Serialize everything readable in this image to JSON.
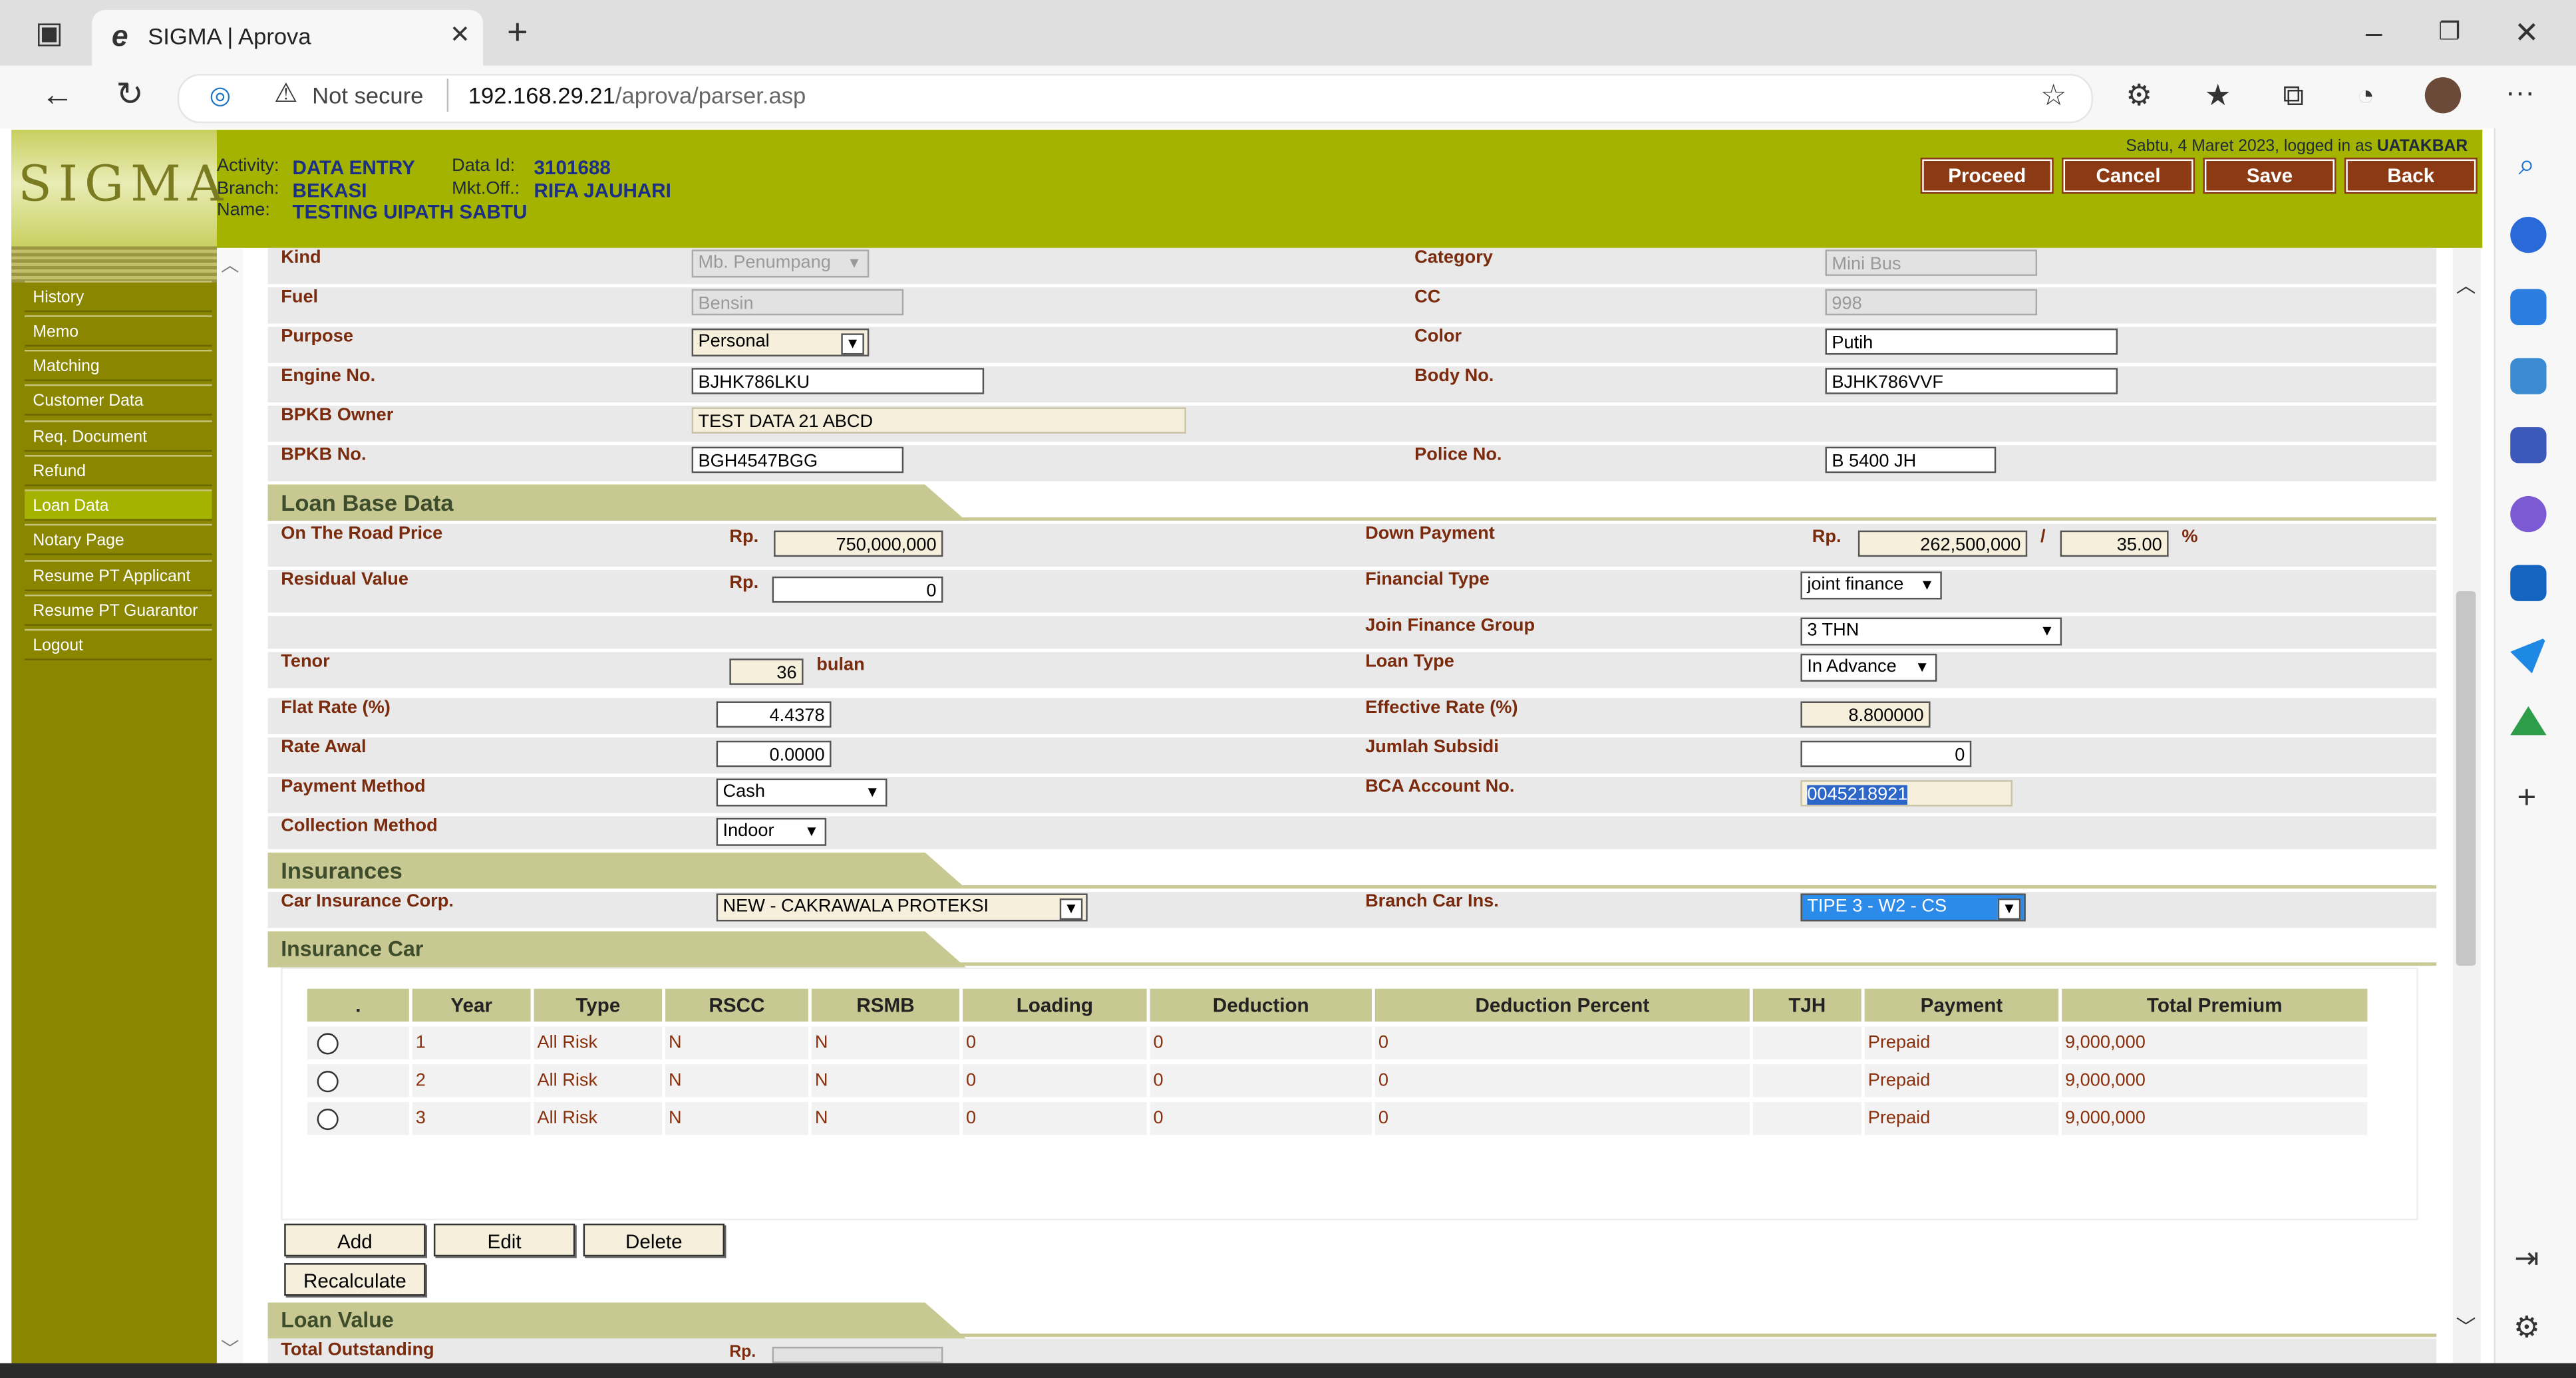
{
  "browser": {
    "tab_title": "SIGMA | Aprova",
    "security": "Not secure",
    "url_host": "192.168.29.21",
    "url_path": "/aprova/parser.asp"
  },
  "header": {
    "logo": "SIGMA",
    "activity_label": "Activity:",
    "activity_value": "DATA ENTRY",
    "branch_label": "Branch:",
    "branch_value": "BEKASI",
    "name_label": "Name:",
    "name_value": "TESTING UIPATH SABTU",
    "dataid_label": "Data Id:",
    "dataid_value": "3101688",
    "mktoff_label": "Mkt.Off.:",
    "mktoff_value": "RIFA JAUHARI",
    "login_info": "Sabtu, 4 Maret 2023, logged in as",
    "login_user": "UATAKBAR",
    "buttons": [
      "Proceed",
      "Cancel",
      "Save",
      "Back"
    ]
  },
  "nav": {
    "items": [
      "History",
      "Memo",
      "Matching",
      "Customer Data",
      "Req. Document",
      "Refund",
      "Loan Data",
      "Notary Page",
      "Resume PT Applicant",
      "Resume PT Guarantor",
      "Logout"
    ],
    "active": "Loan Data"
  },
  "vehicle": {
    "kind_label": "Kind",
    "kind_value": "Mb. Penumpang",
    "category_label": "Category",
    "category_value": "Mini Bus",
    "fuel_label": "Fuel",
    "fuel_value": "Bensin",
    "cc_label": "CC",
    "cc_value": "998",
    "purpose_label": "Purpose",
    "purpose_value": "Personal",
    "color_label": "Color",
    "color_value": "Putih",
    "engine_label": "Engine No.",
    "engine_value": "BJHK786LKU",
    "body_label": "Body No.",
    "body_value": "BJHK786VVF",
    "bpkb_owner_label": "BPKB Owner",
    "bpkb_owner_value": "TEST DATA 21 ABCD",
    "bpkb_no_label": "BPKB No.",
    "bpkb_no_value": "BGH4547BGG",
    "police_label": "Police No.",
    "police_value": "B 5400 JH"
  },
  "loan_base": {
    "section_title": "Loan Base Data",
    "otr_label": "On The Road Price",
    "currency": "Rp.",
    "otr_value": "750,000,000",
    "dp_label": "Down Payment",
    "dp_value": "262,500,000",
    "dp_sep": "/",
    "dp_percent": "35.00",
    "percent_sign": "%",
    "residual_label": "Residual Value",
    "residual_value": "0",
    "fintype_label": "Financial Type",
    "fintype_value": "joint finance",
    "joingroup_label": "Join Finance Group",
    "joingroup_value": "3 THN",
    "tenor_label": "Tenor",
    "tenor_value": "36",
    "tenor_unit": "bulan",
    "loantype_label": "Loan Type",
    "loantype_value": "In Advance",
    "flatrate_label": "Flat Rate (%)",
    "flatrate_value": "4.4378",
    "effrate_label": "Effective Rate (%)",
    "effrate_value": "8.800000",
    "rateawal_label": "Rate Awal",
    "rateawal_value": "0.0000",
    "subsidi_label": "Jumlah Subsidi",
    "subsidi_value": "0",
    "paymethod_label": "Payment Method",
    "paymethod_value": "Cash",
    "bca_label": "BCA Account No.",
    "bca_value": "0045218921",
    "collmethod_label": "Collection Method",
    "collmethod_value": "Indoor"
  },
  "insurances": {
    "section_title": "Insurances",
    "corp_label": "Car Insurance Corp.",
    "corp_value": "NEW - CAKRAWALA PROTEKSI",
    "branch_label": "Branch Car Ins.",
    "branch_value": "TIPE 3 - W2 - CS"
  },
  "insurance_car": {
    "section_title": "Insurance Car",
    "columns": [
      ".",
      "Year",
      "Type",
      "RSCC",
      "RSMB",
      "Loading",
      "Deduction",
      "Deduction Percent",
      "TJH",
      "Payment",
      "Total Premium"
    ],
    "rows": [
      [
        "",
        "1",
        "All Risk",
        "N",
        "N",
        "0",
        "0",
        "0",
        "",
        "Prepaid",
        "9,000,000"
      ],
      [
        "",
        "2",
        "All Risk",
        "N",
        "N",
        "0",
        "0",
        "0",
        "",
        "Prepaid",
        "9,000,000"
      ],
      [
        "",
        "3",
        "All Risk",
        "N",
        "N",
        "0",
        "0",
        "0",
        "",
        "Prepaid",
        "9,000,000"
      ]
    ],
    "buttons": {
      "add": "Add",
      "edit": "Edit",
      "delete": "Delete",
      "recalculate": "Recalculate"
    }
  },
  "loan_value": {
    "section_title": "Loan Value",
    "outstanding_label": "Total Outstanding",
    "currency": "Rp."
  },
  "colors": {
    "header": "#a3b300",
    "nav": "#8a8600",
    "label": "#7a2a0d",
    "section": "#c8c893",
    "button": "#8c3a14"
  }
}
